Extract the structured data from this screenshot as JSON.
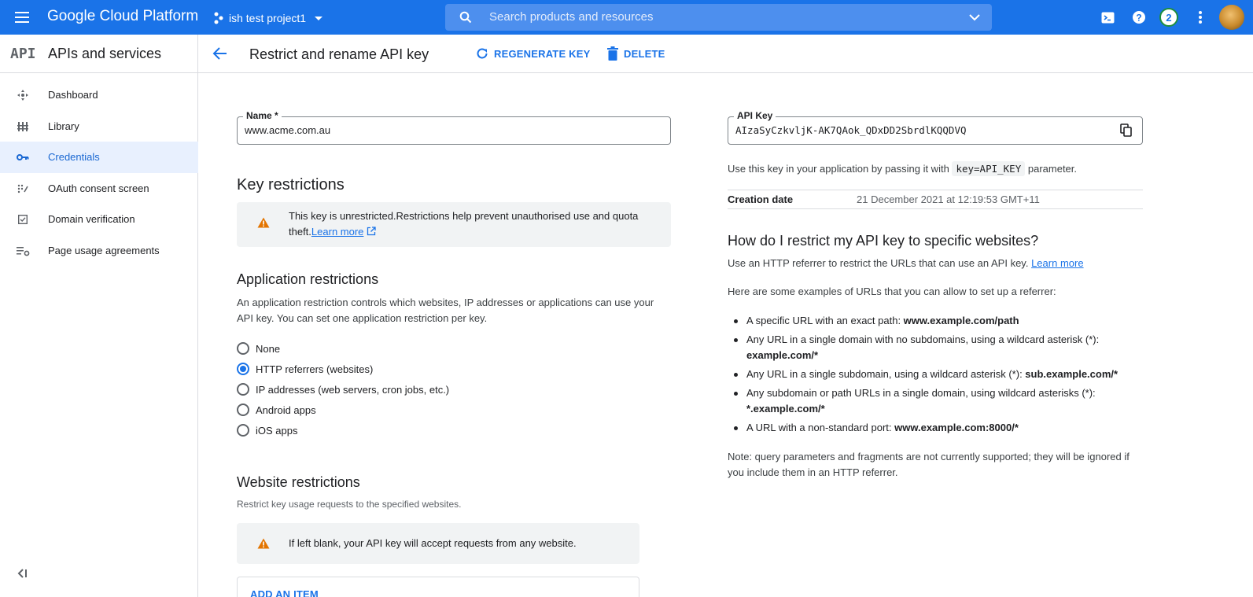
{
  "topbar": {
    "app_title": "Google Cloud Platform",
    "project_name": "ish test project1",
    "search_placeholder": "Search products and resources",
    "notification_count": "2",
    "color": "#1a73e8"
  },
  "sidebar": {
    "logo_text": "API",
    "title": "APIs and services",
    "items": [
      {
        "label": "Dashboard",
        "icon": "dashboard-icon"
      },
      {
        "label": "Library",
        "icon": "library-icon"
      },
      {
        "label": "Credentials",
        "icon": "key-icon",
        "active": true
      },
      {
        "label": "OAuth consent screen",
        "icon": "oauth-icon"
      },
      {
        "label": "Domain verification",
        "icon": "checkbox-icon"
      },
      {
        "label": "Page usage agreements",
        "icon": "settings-list-icon"
      }
    ]
  },
  "header": {
    "title": "Restrict and rename API key",
    "regenerate_label": "REGENERATE KEY",
    "delete_label": "DELETE"
  },
  "name_field": {
    "label": "Name *",
    "value": "www.acme.com.au"
  },
  "key_restrictions": {
    "heading": "Key restrictions",
    "warning_text": "This key is unrestricted.Restrictions help prevent unauthorised use and quota theft.",
    "learn_more": "Learn more"
  },
  "application_restrictions": {
    "heading": "Application restrictions",
    "description": "An application restriction controls which websites, IP addresses or applications can use your API key. You can set one application restriction per key.",
    "options": [
      {
        "label": "None",
        "checked": false
      },
      {
        "label": "HTTP referrers (websites)",
        "checked": true
      },
      {
        "label": "IP addresses (web servers, cron jobs, etc.)",
        "checked": false
      },
      {
        "label": "Android apps",
        "checked": false
      },
      {
        "label": "iOS apps",
        "checked": false
      }
    ]
  },
  "website_restrictions": {
    "heading": "Website restrictions",
    "description": "Restrict key usage requests to the specified websites.",
    "warning_text": "If left blank, your API key will accept requests from any website.",
    "add_item_label": "ADD AN ITEM"
  },
  "api_key": {
    "label": "API Key",
    "value": "AIzaSyCzkvljK-AK7QAok_QDxDD2SbrdlKQQDVQ",
    "usage_prefix": "Use this key in your application by passing it with",
    "usage_code": "key=API_KEY",
    "usage_suffix": "parameter.",
    "creation_label": "Creation date",
    "creation_value": "21 December 2021 at 12:19:53 GMT+11"
  },
  "help": {
    "heading": "How do I restrict my API key to specific websites?",
    "intro": "Use an HTTP referrer to restrict the URLs that can use an API key.",
    "intro_link": "Learn more",
    "examples_intro": "Here are some examples of URLs that you can allow to set up a referrer:",
    "bullets": [
      {
        "text": "A specific URL with an exact path: ",
        "bold": "www.example.com/path"
      },
      {
        "text": "Any URL in a single domain with no subdomains, using a wildcard asterisk (*): ",
        "bold": "example.com/*"
      },
      {
        "text": "Any URL in a single subdomain, using a wildcard asterisk (*): ",
        "bold": "sub.example.com/*"
      },
      {
        "text": "Any subdomain or path URLs in a single domain, using wildcard asterisks (*): ",
        "bold": "*.example.com/*"
      },
      {
        "text": "A URL with a non-standard port: ",
        "bold": "www.example.com:8000/*"
      }
    ],
    "note": "Note: query parameters and fragments are not currently supported; they will be ignored if you include them in an HTTP referrer."
  }
}
